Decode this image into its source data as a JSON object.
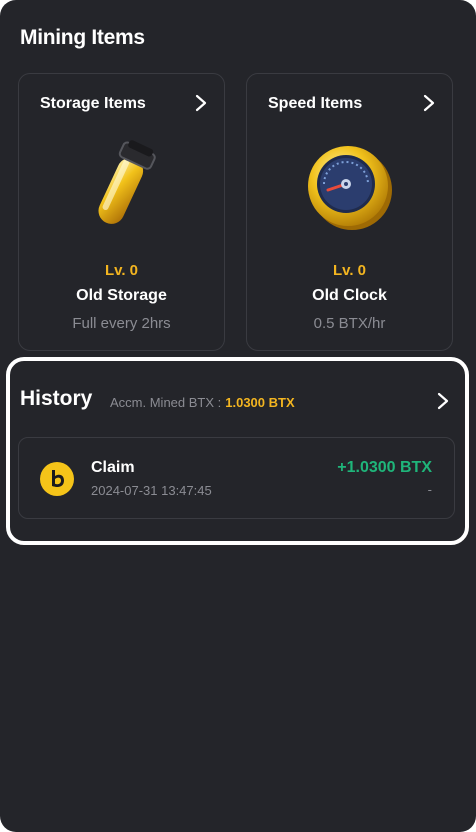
{
  "mining": {
    "title": "Mining Items",
    "storage": {
      "title": "Storage Items",
      "level": "Lv. 0",
      "name": "Old Storage",
      "desc": "Full every 2hrs",
      "icon": "storage-vial-icon"
    },
    "speed": {
      "title": "Speed Items",
      "level": "Lv. 0",
      "name": "Old Clock",
      "desc": "0.5 BTX/hr",
      "icon": "speed-gauge-icon"
    }
  },
  "history": {
    "title": "History",
    "accm_label": "Accm. Mined BTX :",
    "accm_value": "1.0300 BTX",
    "rows": [
      {
        "label": "Claim",
        "time": "2024-07-31 13:47:45",
        "amount": "+1.0300 BTX",
        "sub": "-",
        "icon": "btx-coin-icon"
      }
    ]
  },
  "colors": {
    "background": "#24252a",
    "accent": "#f3b520",
    "positive": "#1fb57a",
    "muted": "#8b8c93"
  }
}
